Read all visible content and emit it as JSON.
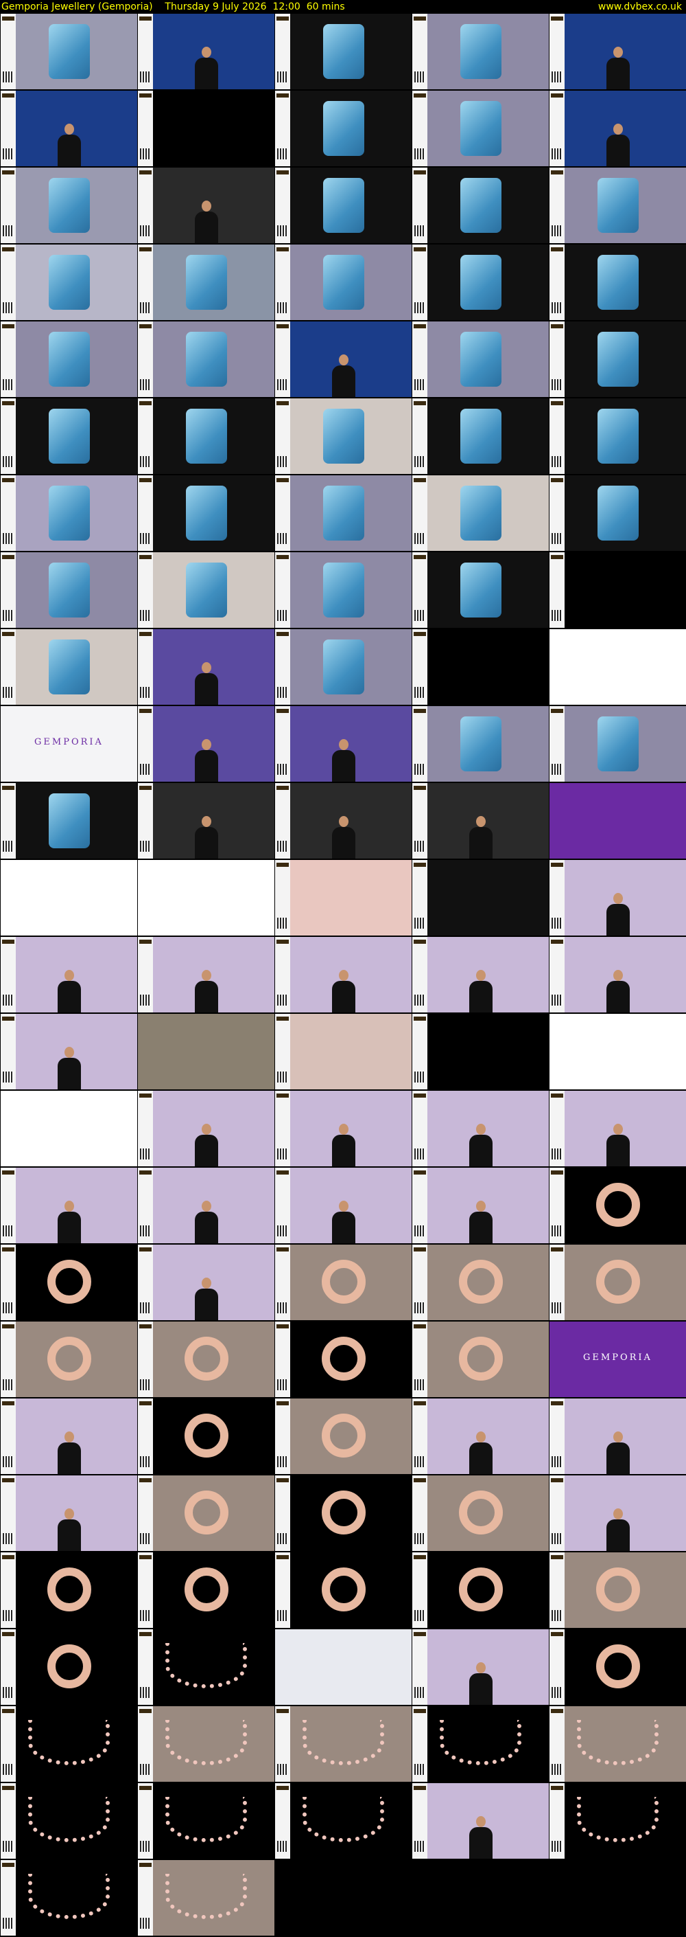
{
  "header": {
    "title": "Gemporia Jewellery (Gemporia)    Thursday 9 July 2026  12:00  60 mins",
    "site": "www.dvbex.co.uk"
  },
  "colors": {
    "header_text": "#ffff00",
    "background": "#000000",
    "purple": "#6b2aa3"
  },
  "thumbnails": [
    {
      "kind": "pendant",
      "bg": "#9a9ab0"
    },
    {
      "kind": "presenter",
      "bg": "#1b3d8a"
    },
    {
      "kind": "pendant",
      "bg": "#111"
    },
    {
      "kind": "pendant",
      "bg": "#8e8aa5"
    },
    {
      "kind": "presenter",
      "bg": "#1b3d8a"
    },
    {
      "kind": "presenter",
      "bg": "#1b3d8a"
    },
    {
      "kind": "dark",
      "bg": "#000"
    },
    {
      "kind": "pendant",
      "bg": "#111"
    },
    {
      "kind": "pendant",
      "bg": "#8e8aa5"
    },
    {
      "kind": "presenter",
      "bg": "#1b3d8a"
    },
    {
      "kind": "pendant",
      "bg": "#9a9ab0"
    },
    {
      "kind": "presenter",
      "bg": "#2a2a2a"
    },
    {
      "kind": "pendant",
      "bg": "#111"
    },
    {
      "kind": "pendant",
      "bg": "#111"
    },
    {
      "kind": "pendant",
      "bg": "#8e8aa5"
    },
    {
      "kind": "pendant",
      "bg": "#b7b6c8"
    },
    {
      "kind": "pendant",
      "bg": "#8a94a6"
    },
    {
      "kind": "pendant",
      "bg": "#8e8aa5"
    },
    {
      "kind": "pendant",
      "bg": "#111"
    },
    {
      "kind": "pendant",
      "bg": "#111"
    },
    {
      "kind": "pendant",
      "bg": "#8e8aa5"
    },
    {
      "kind": "pendant",
      "bg": "#8e8aa5"
    },
    {
      "kind": "presenter",
      "bg": "#1b3d8a"
    },
    {
      "kind": "pendant",
      "bg": "#8e8aa5"
    },
    {
      "kind": "pendant",
      "bg": "#111"
    },
    {
      "kind": "pendant",
      "bg": "#111"
    },
    {
      "kind": "pendant",
      "bg": "#111"
    },
    {
      "kind": "pendant",
      "bg": "#d0c8c2"
    },
    {
      "kind": "pendant",
      "bg": "#111"
    },
    {
      "kind": "pendant",
      "bg": "#111"
    },
    {
      "kind": "pendant",
      "bg": "#a9a3c0"
    },
    {
      "kind": "pendant",
      "bg": "#111"
    },
    {
      "kind": "pendant",
      "bg": "#8e8aa5"
    },
    {
      "kind": "pendant",
      "bg": "#d0c8c2"
    },
    {
      "kind": "pendant",
      "bg": "#111"
    },
    {
      "kind": "pendant",
      "bg": "#8e8aa5"
    },
    {
      "kind": "pendant",
      "bg": "#d0c8c2"
    },
    {
      "kind": "pendant",
      "bg": "#8e8aa5"
    },
    {
      "kind": "pendant",
      "bg": "#111"
    },
    {
      "kind": "dark",
      "bg": "#000"
    },
    {
      "kind": "pendant",
      "bg": "#d0c8c2"
    },
    {
      "kind": "presenter",
      "bg": "#5a4aa0"
    },
    {
      "kind": "pendant",
      "bg": "#8e8aa5"
    },
    {
      "kind": "dark",
      "bg": "#000"
    },
    {
      "kind": "phone",
      "bg": "#ffffff"
    },
    {
      "kind": "logo",
      "bg": "#f4f4f6",
      "label": "GEMPORIA"
    },
    {
      "kind": "presenter",
      "bg": "#5a4aa0"
    },
    {
      "kind": "presenter",
      "bg": "#5a4aa0"
    },
    {
      "kind": "pendant",
      "bg": "#8e8aa5"
    },
    {
      "kind": "pendant",
      "bg": "#8e8aa5"
    },
    {
      "kind": "pendant",
      "bg": "#111"
    },
    {
      "kind": "presenter",
      "bg": "#2a2a2a"
    },
    {
      "kind": "presenter",
      "bg": "#2a2a2a"
    },
    {
      "kind": "presenter",
      "bg": "#2a2a2a"
    },
    {
      "kind": "purple",
      "bg": "#6b2aa3"
    },
    {
      "kind": "white",
      "bg": "#ffffff"
    },
    {
      "kind": "phone",
      "bg": "#ffffff"
    },
    {
      "kind": "pink",
      "bg": "#e9c7c0"
    },
    {
      "kind": "dark",
      "bg": "#111"
    },
    {
      "kind": "presenter",
      "bg": "#c8b8d8"
    },
    {
      "kind": "presenter",
      "bg": "#c8b8d8"
    },
    {
      "kind": "presenter",
      "bg": "#c8b8d8"
    },
    {
      "kind": "presenter",
      "bg": "#c8b8d8"
    },
    {
      "kind": "presenter",
      "bg": "#c8b8d8"
    },
    {
      "kind": "presenter",
      "bg": "#c8b8d8"
    },
    {
      "kind": "presenter",
      "bg": "#c8b8d8"
    },
    {
      "kind": "gems",
      "bg": "#8a8070"
    },
    {
      "kind": "pink",
      "bg": "#d8c0b8"
    },
    {
      "kind": "dark",
      "bg": "#000"
    },
    {
      "kind": "white",
      "bg": "#ffffff"
    },
    {
      "kind": "white",
      "bg": "#ffffff"
    },
    {
      "kind": "presenter",
      "bg": "#c8b8d8"
    },
    {
      "kind": "presenter",
      "bg": "#c8b8d8"
    },
    {
      "kind": "presenter",
      "bg": "#c8b8d8"
    },
    {
      "kind": "presenter",
      "bg": "#c8b8d8"
    },
    {
      "kind": "presenter",
      "bg": "#c8b8d8"
    },
    {
      "kind": "presenter",
      "bg": "#c8b8d8"
    },
    {
      "kind": "presenter",
      "bg": "#c8b8d8"
    },
    {
      "kind": "presenter",
      "bg": "#c8b8d8"
    },
    {
      "kind": "bangle",
      "bg": "#000"
    },
    {
      "kind": "bangle",
      "bg": "#000"
    },
    {
      "kind": "presenter",
      "bg": "#c8b8d8"
    },
    {
      "kind": "bangle",
      "bg": "#9a8a80"
    },
    {
      "kind": "bangle",
      "bg": "#9a8a80"
    },
    {
      "kind": "bangle",
      "bg": "#9a8a80"
    },
    {
      "kind": "bangle",
      "bg": "#9a8a80"
    },
    {
      "kind": "bangle",
      "bg": "#9a8a80"
    },
    {
      "kind": "bangle",
      "bg": "#000"
    },
    {
      "kind": "bangle",
      "bg": "#9a8a80"
    },
    {
      "kind": "logo",
      "bg": "#6b2aa3",
      "label": "GEMPORIA"
    },
    {
      "kind": "presenter",
      "bg": "#c8b8d8"
    },
    {
      "kind": "bangle",
      "bg": "#000"
    },
    {
      "kind": "bangle",
      "bg": "#9a8a80"
    },
    {
      "kind": "presenter",
      "bg": "#c8b8d8"
    },
    {
      "kind": "presenter",
      "bg": "#c8b8d8"
    },
    {
      "kind": "presenter",
      "bg": "#c8b8d8"
    },
    {
      "kind": "bangle",
      "bg": "#9a8a80"
    },
    {
      "kind": "bangle",
      "bg": "#000"
    },
    {
      "kind": "bangle",
      "bg": "#9a8a80"
    },
    {
      "kind": "presenter",
      "bg": "#c8b8d8"
    },
    {
      "kind": "bangle",
      "bg": "#000"
    },
    {
      "kind": "bangle",
      "bg": "#000"
    },
    {
      "kind": "bangle",
      "bg": "#000"
    },
    {
      "kind": "bangle",
      "bg": "#000"
    },
    {
      "kind": "bangle",
      "bg": "#9a8a80"
    },
    {
      "kind": "bangle",
      "bg": "#000"
    },
    {
      "kind": "beads",
      "bg": "#000"
    },
    {
      "kind": "white",
      "bg": "#e8eaf0"
    },
    {
      "kind": "presenter",
      "bg": "#c8b8d8"
    },
    {
      "kind": "bangle",
      "bg": "#000"
    },
    {
      "kind": "beads",
      "bg": "#000"
    },
    {
      "kind": "beads",
      "bg": "#9a8a80"
    },
    {
      "kind": "beads",
      "bg": "#9a8a80"
    },
    {
      "kind": "beads",
      "bg": "#000"
    },
    {
      "kind": "beads",
      "bg": "#9a8a80"
    },
    {
      "kind": "beads",
      "bg": "#000"
    },
    {
      "kind": "beads",
      "bg": "#000"
    },
    {
      "kind": "beads",
      "bg": "#000"
    },
    {
      "kind": "presenter",
      "bg": "#c8b8d8"
    },
    {
      "kind": "beads",
      "bg": "#000"
    },
    {
      "kind": "beads",
      "bg": "#000"
    },
    {
      "kind": "beads",
      "bg": "#9a8a80"
    }
  ]
}
